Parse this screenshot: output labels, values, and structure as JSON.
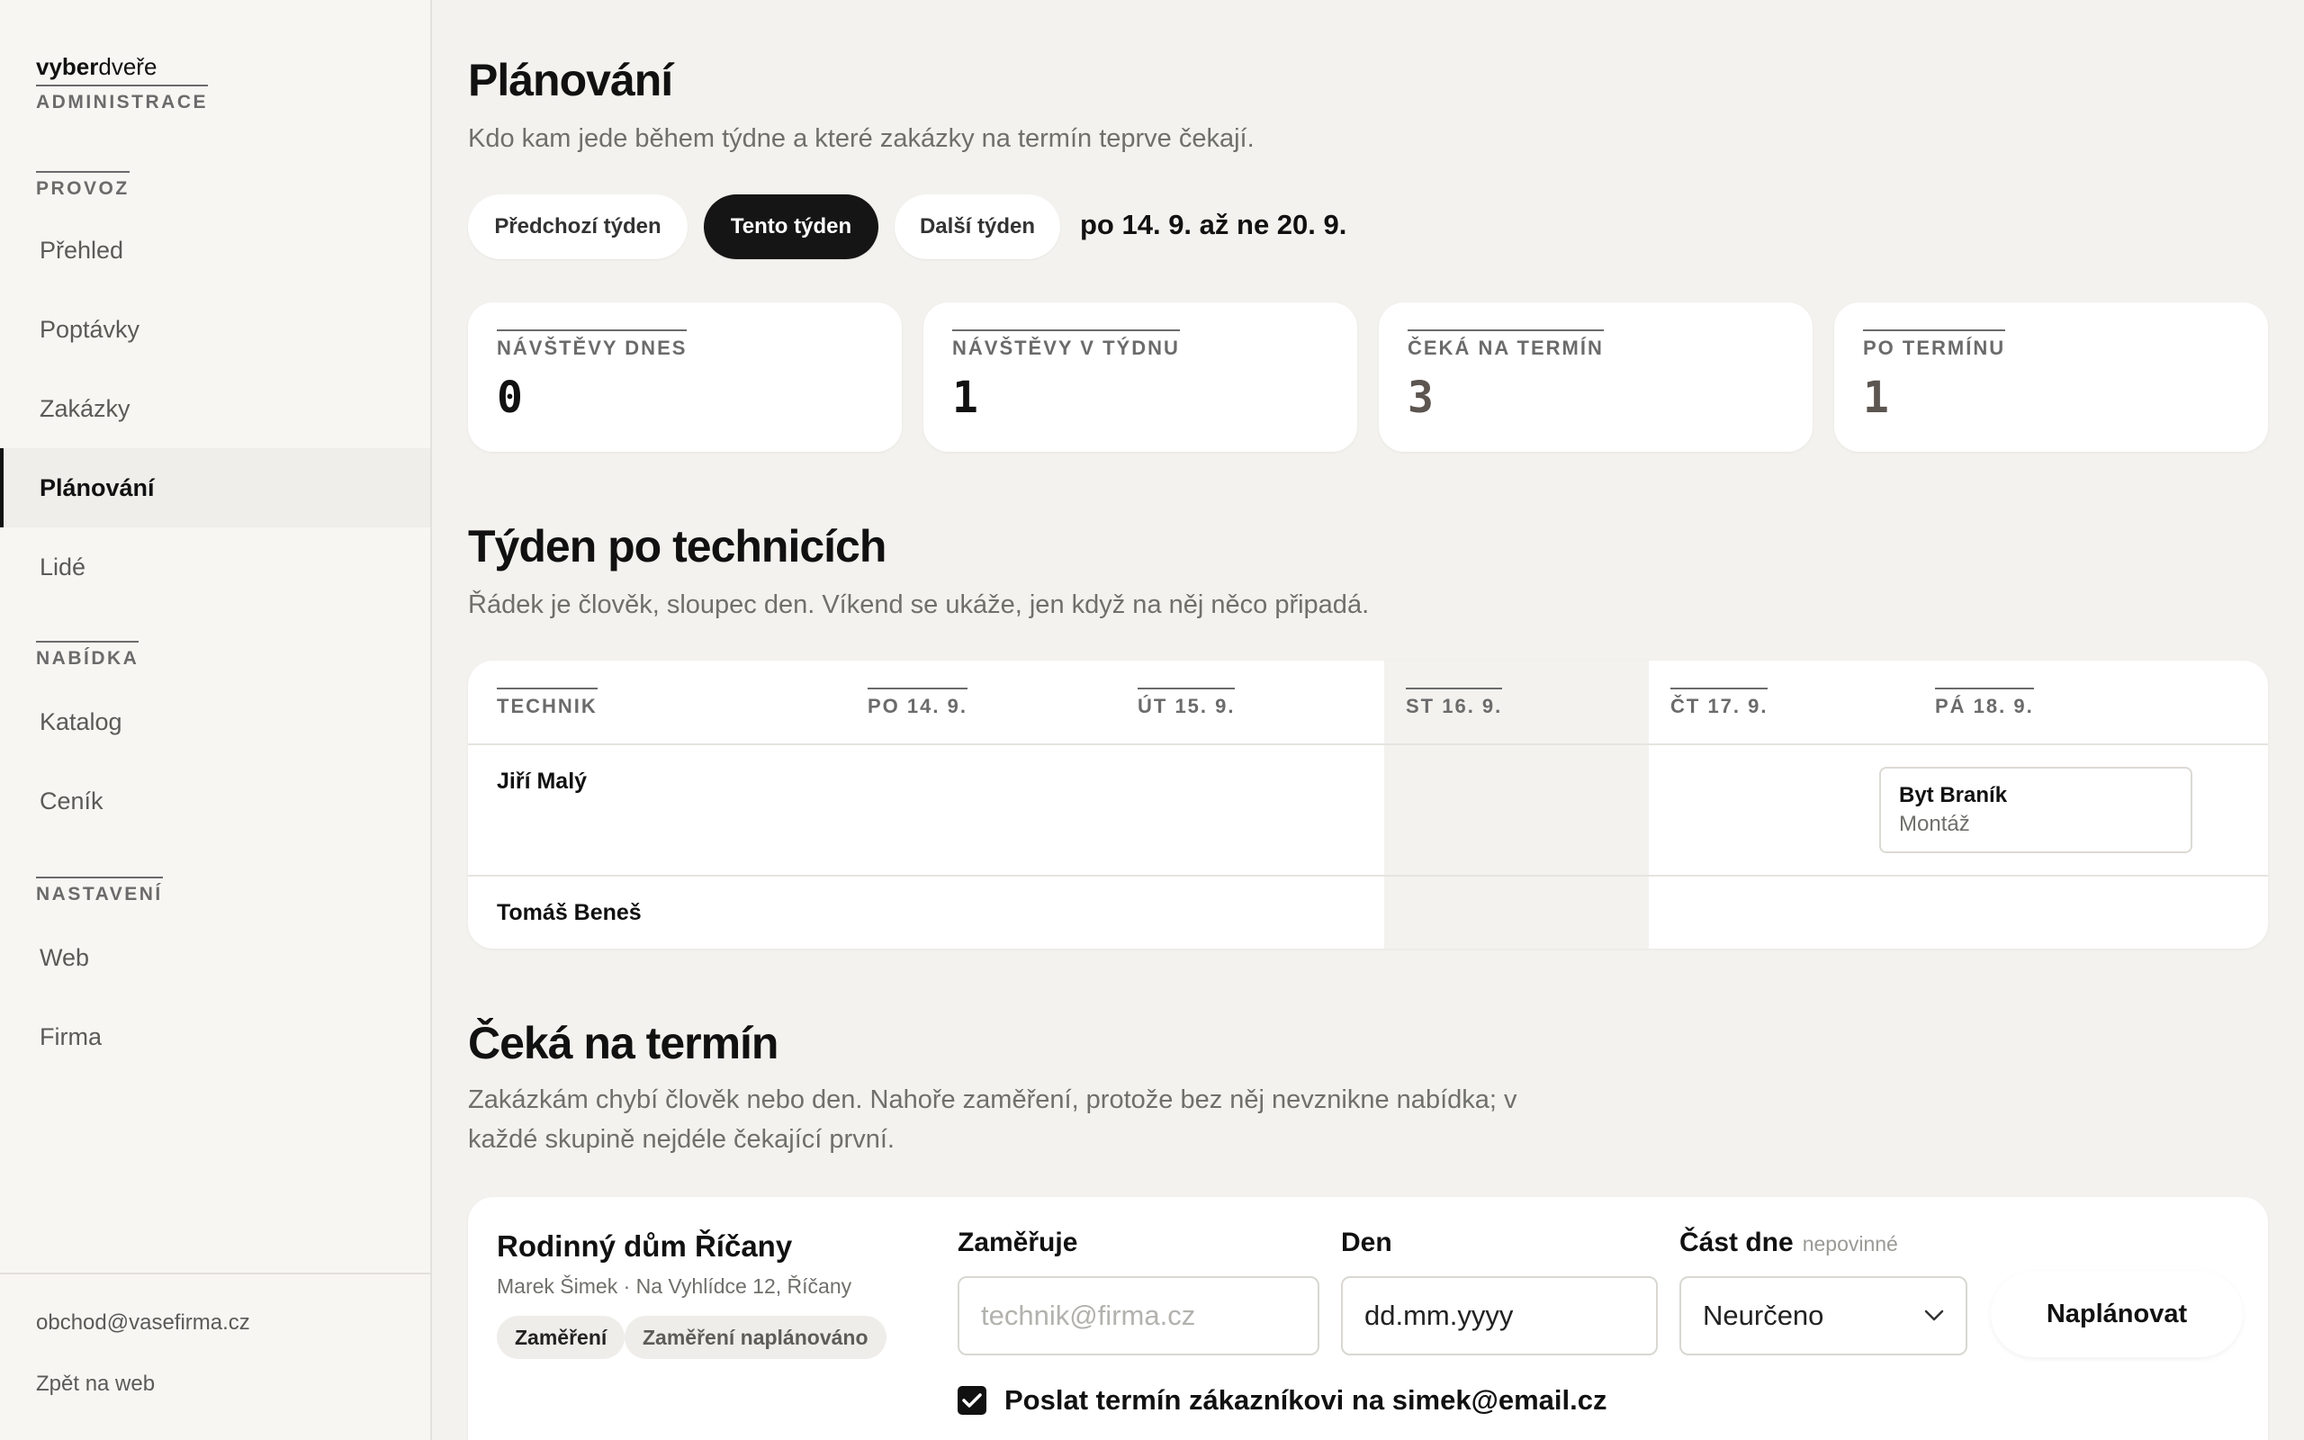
{
  "brand": {
    "name_bold": "vyber",
    "name_regular": "dveře",
    "subtitle": "ADMINISTRACE"
  },
  "sidebar": {
    "sections": [
      {
        "label": "PROVOZ",
        "items": [
          "Přehled",
          "Poptávky",
          "Zakázky",
          "Plánování",
          "Lidé"
        ]
      },
      {
        "label": "NABÍDKA",
        "items": [
          "Katalog",
          "Ceník"
        ]
      },
      {
        "label": "NASTAVENÍ",
        "items": [
          "Web",
          "Firma"
        ]
      }
    ],
    "active_item": "Plánování",
    "footer": {
      "email": "obchod@vasefirma.cz",
      "back_link": "Zpět na web"
    }
  },
  "page": {
    "title": "Plánování",
    "subtitle": "Kdo kam jede během týdne a které zakázky na termín teprve čekají.",
    "week_nav": {
      "prev": "Předchozí týden",
      "current": "Tento týden",
      "next": "Další týden"
    },
    "week_range": "po 14. 9. až ne 20. 9."
  },
  "stats": [
    {
      "label": "NÁVŠTĚVY DNES",
      "value": "0"
    },
    {
      "label": "NÁVŠTĚVY V TÝDNU",
      "value": "1"
    },
    {
      "label": "ČEKÁ NA TERMÍN",
      "value": "3"
    },
    {
      "label": "PO TERMÍNU",
      "value": "1"
    }
  ],
  "week_section": {
    "title": "Týden po technicích",
    "subtitle": "Řádek je člověk, sloupec den. Víkend se ukáže, jen když na něj něco připadá.",
    "columns": [
      "TECHNIK",
      "PO 14. 9.",
      "ÚT 15. 9.",
      "ST 16. 9.",
      "ČT 17. 9.",
      "PÁ 18. 9."
    ],
    "rows": [
      {
        "technician": "Jiří Malý",
        "event": {
          "title": "Byt Braník",
          "type": "Montáž",
          "day": "PÁ 18. 9."
        }
      },
      {
        "technician": "Tomáš Beneš"
      }
    ]
  },
  "waiting_section": {
    "title": "Čeká na termín",
    "subtitle_line1": "Zakázkám chybí člověk nebo den. Nahoře zaměření, protože bez něj nevznikne nabídka; v",
    "subtitle_line2": "každé skupině nejdéle čekající první.",
    "job": {
      "title": "Rodinný dům Říčany",
      "meta": "Marek Šimek · Na Vyhlídce 12, Říčany",
      "tags": [
        "Zaměření",
        "Zaměření naplánováno"
      ],
      "fields": {
        "measurer_label": "Zaměřuje",
        "measurer_placeholder": "technik@firma.cz",
        "day_label": "Den",
        "day_placeholder": "dd.mm.yyyy",
        "part_label": "Část dne",
        "part_hint": "nepovinné",
        "part_value": "Neurčeno"
      },
      "submit": "Naplánovat",
      "notify_label": "Poslat termín zákazníkovi na simek@email.cz",
      "notify_checked": true
    }
  }
}
